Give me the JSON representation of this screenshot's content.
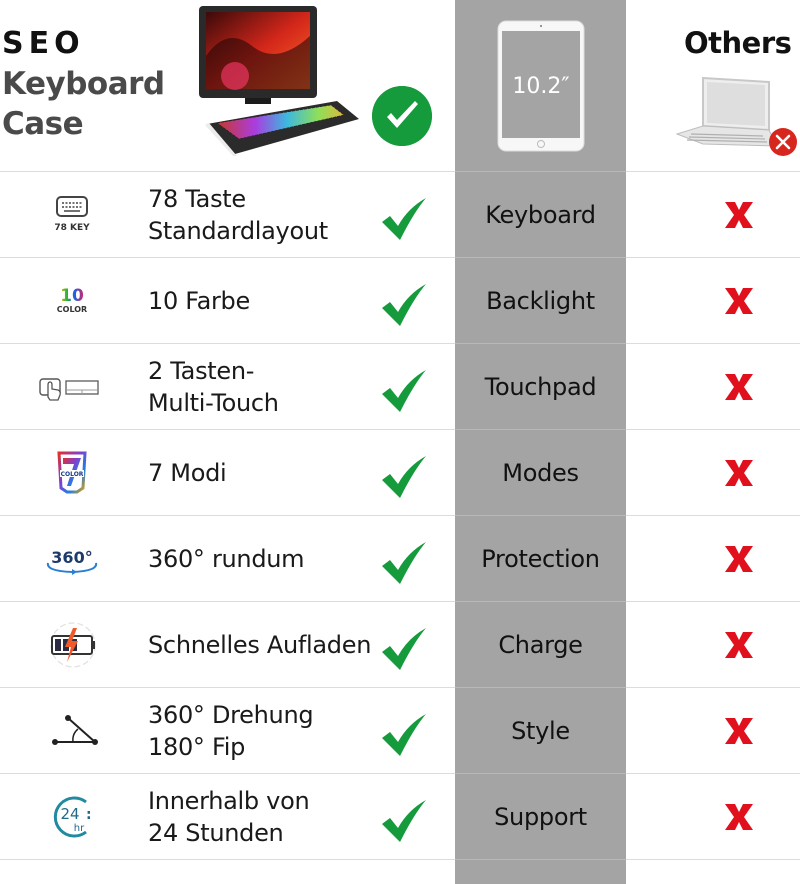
{
  "header": {
    "brand_line1": "SEO",
    "brand_line2": "Keyboard",
    "brand_line3": "Case",
    "tablet_size_label": "10.2″",
    "others_title": "Others"
  },
  "colors": {
    "check_green": "#159a3c",
    "cross_red": "#e0101c",
    "middle_column_gray": "#a4a4a4"
  },
  "rows": [
    {
      "icon": "keyboard-78-key-icon",
      "icon_text": "78 KEY",
      "feature_line1": "78 Taste",
      "feature_line2": "Standardlayout",
      "label": "Keyboard",
      "ours": "check",
      "others": "cross"
    },
    {
      "icon": "10-color-icon",
      "icon_text_top": "10",
      "icon_text": "COLOR",
      "feature_line1": "10 Farbe",
      "feature_line2": "",
      "label": "Backlight",
      "ours": "check",
      "others": "cross"
    },
    {
      "icon": "touchpad-icon",
      "feature_line1": "2 Tasten-",
      "feature_line2": "Multi-Touch",
      "label": "Touchpad",
      "ours": "check",
      "others": "cross"
    },
    {
      "icon": "7-color-modes-icon",
      "icon_text": "COLOR",
      "feature_line1": "7 Modi",
      "feature_line2": "",
      "label": "Modes",
      "ours": "check",
      "others": "cross"
    },
    {
      "icon": "360-rotation-icon",
      "icon_text": "360°",
      "feature_line1": "360° rundum",
      "feature_line2": "",
      "label": "Protection",
      "ours": "check",
      "others": "cross"
    },
    {
      "icon": "fast-charge-battery-icon",
      "feature_line1": "Schnelles Aufladen",
      "feature_line2": "",
      "label": "Charge",
      "ours": "check",
      "others": "cross"
    },
    {
      "icon": "angle-icon",
      "feature_line1": "360° Drehung",
      "feature_line2": "180° Fip",
      "label": "Style",
      "ours": "check",
      "others": "cross"
    },
    {
      "icon": "24-hour-support-icon",
      "icon_text_top": "24",
      "icon_text": "hr",
      "feature_line1": "Innerhalb von",
      "feature_line2": "24 Stunden",
      "label": "Support",
      "ours": "check",
      "others": "cross"
    }
  ]
}
